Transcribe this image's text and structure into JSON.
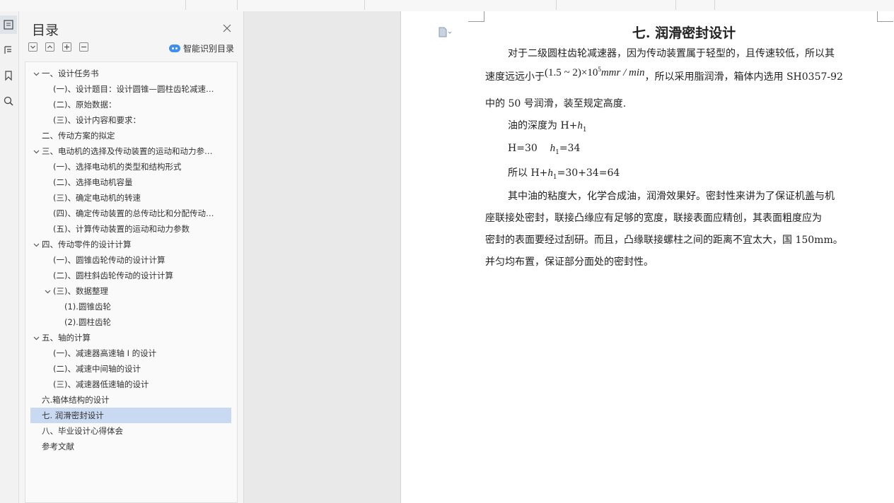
{
  "rail": {
    "items": [
      {
        "name": "toc-panel-icon",
        "active": true
      },
      {
        "name": "outline-panel-icon",
        "active": false
      },
      {
        "name": "bookmark-icon",
        "active": false
      },
      {
        "name": "search-icon",
        "active": false
      }
    ]
  },
  "toc": {
    "title": "目录",
    "smart_label": "智能识别目录",
    "items": [
      {
        "label": "一、设计任务书",
        "level": 0,
        "caret": "down"
      },
      {
        "label": "(一)、设计题目：设计圆锥—圆柱齿轮减速…",
        "level": 1,
        "caret": ""
      },
      {
        "label": "(二)、原始数据：",
        "level": 1,
        "caret": ""
      },
      {
        "label": "(三)、设计内容和要求：",
        "level": 1,
        "caret": ""
      },
      {
        "label": "二、传动方案的拟定",
        "level": 0,
        "caret": ""
      },
      {
        "label": "三、电动机的选择及传动装置的运动和动力参…",
        "level": 0,
        "caret": "down"
      },
      {
        "label": "(一)、选择电动机的类型和结构形式",
        "level": 1,
        "caret": ""
      },
      {
        "label": "(二)、选择电动机容量",
        "level": 1,
        "caret": ""
      },
      {
        "label": "(三)、确定电动机的转速",
        "level": 1,
        "caret": ""
      },
      {
        "label": "(四)、确定传动装置的总传动比和分配传动…",
        "level": 1,
        "caret": ""
      },
      {
        "label": "(五)、计算传动装置的运动和动力参数",
        "level": 1,
        "caret": ""
      },
      {
        "label": "四、传动零件的设计计算",
        "level": 0,
        "caret": "down"
      },
      {
        "label": "(一)、圆锥齿轮传动的设计计算",
        "level": 1,
        "caret": ""
      },
      {
        "label": "(二)、圆柱斜齿轮传动的设计计算",
        "level": 1,
        "caret": ""
      },
      {
        "label": "(三)、数据整理",
        "level": 1,
        "caret": "down"
      },
      {
        "label": "(1).圆锥齿轮",
        "level": 2,
        "caret": ""
      },
      {
        "label": "(2).圆柱齿轮",
        "level": 2,
        "caret": ""
      },
      {
        "label": "五、轴的计算",
        "level": 0,
        "caret": "down"
      },
      {
        "label": "(一)、减速器高速轴 I 的设计",
        "level": 1,
        "caret": ""
      },
      {
        "label": "(二)、减速中间轴的设计",
        "level": 1,
        "caret": ""
      },
      {
        "label": "(三)、减速器低速轴的设计",
        "level": 1,
        "caret": ""
      },
      {
        "label": "六.箱体结构的设计",
        "level": 0,
        "caret": ""
      },
      {
        "label": "七. 润滑密封设计",
        "level": 0,
        "caret": "",
        "selected": true
      },
      {
        "label": "八、毕业设计心得体会",
        "level": 0,
        "caret": ""
      },
      {
        "label": "参考文献",
        "level": 0,
        "caret": ""
      }
    ]
  },
  "doc": {
    "heading": "七.   润滑密封设计",
    "p1_line1": "对于二级圆柱齿轮减速器，因为传动装置属于轻型的，且传速较低，所以其",
    "p1_line2_pre": "速度远远小于",
    "p1_formula": "(1.5 ~ 2)×10",
    "p1_formula_exp": "5",
    "p1_formula_unit": "mmr / min",
    "p1_line2_post": "，所以采用脂润滑，箱体内选用 SH0357-92",
    "p1_line3": "中的 50 号润滑，装至规定高度.",
    "l_depth_pre": "油的深度为 H+",
    "l_depth_h": "h",
    "l_depth_sub": "1",
    "l_h_pre": "H=30",
    "l_h_h": "h",
    "l_h_sub": "1",
    "l_h_post": "=34",
    "l_sum_pre": "所以 H+",
    "l_sum_h": "h",
    "l_sum_sub": "1",
    "l_sum_post": "=30+34=64",
    "p2_line1": "其中油的粘度大，化学合成油，润滑效果好。密封性来讲为了保证机盖与机",
    "p2_line2": "座联接处密封，联接凸缘应有足够的宽度，联接表面应精创，其表面粗度应为",
    "p2_line3": "密封的表面要经过刮研。而且，凸缘联接螺柱之间的距离不宜太大，国 150mm。",
    "p2_line4": "并匀均布置，保证部分面处的密封性。"
  }
}
